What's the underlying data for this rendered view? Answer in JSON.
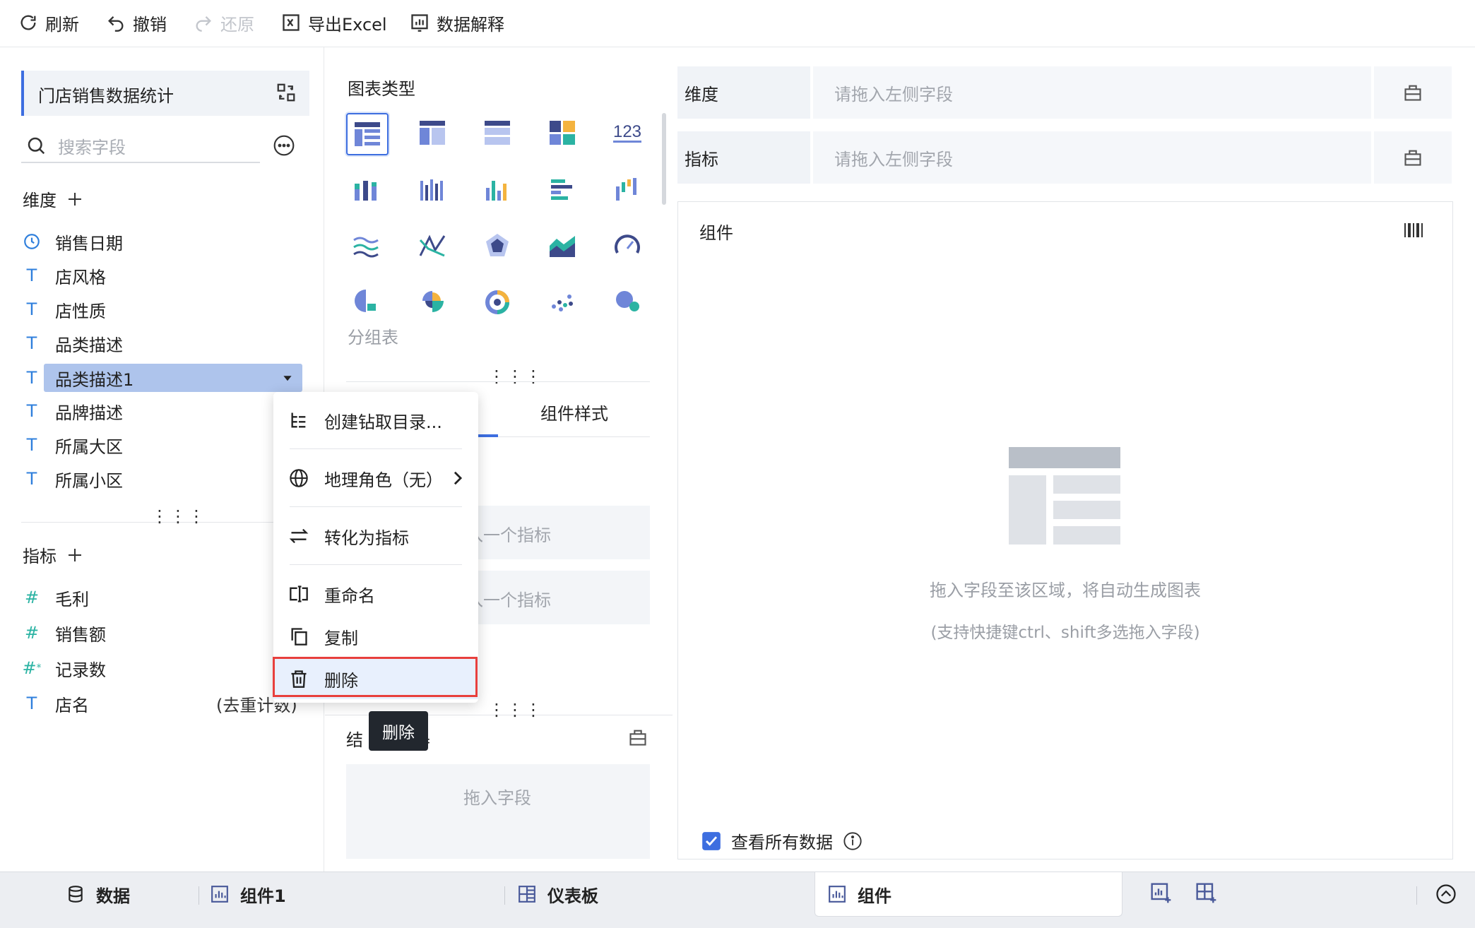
{
  "toolbar": {
    "refresh": "刷新",
    "undo": "撤销",
    "redo": "还原",
    "export": "导出Excel",
    "explain": "数据解释"
  },
  "left": {
    "dataset_name": "门店销售数据统计",
    "search_placeholder": "搜索字段",
    "dimensions_title": "维度",
    "dimensions": [
      {
        "name": "销售日期",
        "icon": "clock-icon"
      },
      {
        "name": "店风格",
        "icon": "text-type-icon"
      },
      {
        "name": "店性质",
        "icon": "text-type-icon"
      },
      {
        "name": "品类描述",
        "icon": "text-type-icon"
      },
      {
        "name": "品类描述1",
        "icon": "text-type-icon"
      },
      {
        "name": "品牌描述",
        "icon": "text-type-icon"
      },
      {
        "name": "所属大区",
        "icon": "text-type-icon"
      },
      {
        "name": "所属小区",
        "icon": "text-type-icon"
      }
    ],
    "metrics_title": "指标",
    "metrics": [
      {
        "name": "毛利",
        "icon": "number-icon"
      },
      {
        "name": "销售额",
        "icon": "number-icon"
      },
      {
        "name": "记录数",
        "icon": "number-star-icon"
      },
      {
        "name": "店名",
        "icon": "text-type-icon",
        "suffix": "(去重计数)"
      }
    ]
  },
  "middle": {
    "chart_type_title": "图表类型",
    "selected_chart_label": "分组表",
    "tab_style": "组件样式",
    "metric_placeholder_1": "入一个指标",
    "metric_placeholder_2": "入一个指标",
    "result_filter_prefix": "结",
    "result_filter_suffix": "器",
    "result_drop_placeholder": "拖入字段"
  },
  "right": {
    "dimension_label": "维度",
    "metric_label": "指标",
    "drop_placeholder": "请拖入左侧字段",
    "component_title": "组件",
    "empty_hint_1": "拖入字段至该区域，将自动生成图表",
    "empty_hint_2": "(支持快捷键ctrl、shift多选拖入字段)",
    "view_all_data": "查看所有数据"
  },
  "context_menu": {
    "items": [
      {
        "label": "创建钻取目录...",
        "icon": "drill-tree-icon"
      },
      {
        "label": "地理角色（无）",
        "icon": "globe-icon"
      },
      {
        "label": "转化为指标",
        "icon": "convert-arrows-icon"
      },
      {
        "label": "重命名",
        "icon": "rename-icon"
      },
      {
        "label": "复制",
        "icon": "copy-icon"
      },
      {
        "label": "删除",
        "icon": "trash-icon"
      }
    ],
    "highlight_color": "#e8403d"
  },
  "tooltip": "删除",
  "bottom_tabs": {
    "data": "数据",
    "component1": "组件1",
    "dashboard": "仪表板",
    "component": "组件"
  },
  "colors": {
    "accent": "#3d6ee0",
    "selected_field_bg": "#aec4ec",
    "teal": "#2bb3a3"
  }
}
